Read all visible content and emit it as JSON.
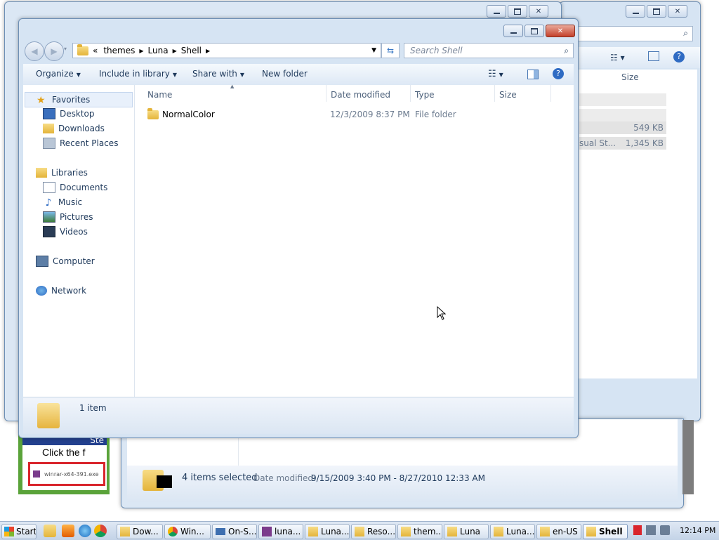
{
  "back_window_right": {
    "column_size": "Size",
    "rows": [
      {
        "name": "",
        "size": "549 KB"
      },
      {
        "name": "sual St...",
        "size": "1,345 KB"
      }
    ]
  },
  "back_window_bottom": {
    "status_count": "4 items selected",
    "date_label": "Date modified:",
    "date_range": "9/15/2009 3:40 PM - 8/27/2010 12:33 AM"
  },
  "background_page": {
    "step_text": "Ste",
    "click_text": "Click the f",
    "file_name": "winrar-x64-391.exe"
  },
  "explorer": {
    "breadcrumb": [
      "themes",
      "Luna",
      "Shell"
    ],
    "breadcrumb_prefix": "«",
    "search_placeholder": "Search Shell",
    "toolbar": {
      "organize": "Organize",
      "include_in_library": "Include in library",
      "share_with": "Share with",
      "new_folder": "New folder"
    },
    "nav": {
      "favorites": "Favorites",
      "desktop": "Desktop",
      "downloads": "Downloads",
      "recent_places": "Recent Places",
      "libraries": "Libraries",
      "documents": "Documents",
      "music": "Music",
      "pictures": "Pictures",
      "videos": "Videos",
      "computer": "Computer",
      "network": "Network"
    },
    "columns": {
      "name": "Name",
      "date_modified": "Date modified",
      "type": "Type",
      "size": "Size"
    },
    "files": [
      {
        "name": "NormalColor",
        "date_modified": "12/3/2009 8:37 PM",
        "type": "File folder",
        "size": ""
      }
    ],
    "status": "1 item"
  },
  "taskbar": {
    "start": "Start",
    "items": [
      "Dow...",
      "Win...",
      "On-S...",
      "luna...",
      "Luna...",
      "Reso...",
      "them...",
      "Luna",
      "Luna...",
      "en-US",
      "Shell"
    ],
    "active_index": 10,
    "clock": "12:14 PM"
  },
  "colors": {
    "accent": "#1e395b",
    "close_button": "#c4402a",
    "folder": "#e4b43a"
  }
}
